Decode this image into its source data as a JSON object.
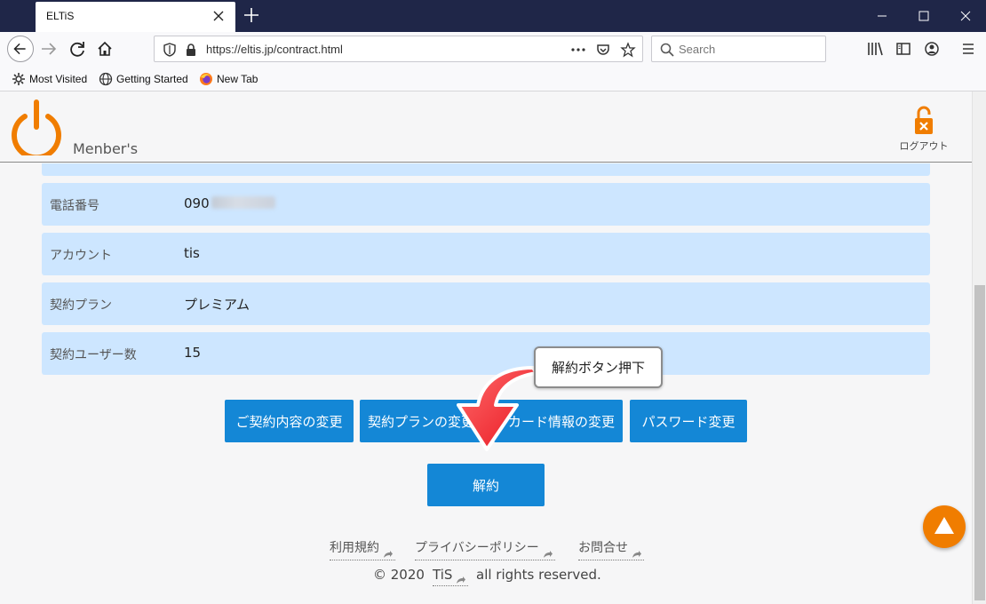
{
  "browser": {
    "tab_title": "ELTiS",
    "url": "https://eltis.jp/contract.html",
    "search_placeholder": "Search",
    "bookmarks": [
      "Most Visited",
      "Getting Started",
      "New Tab"
    ]
  },
  "header": {
    "brand": "Menber's",
    "logout_label": "ログアウト",
    "accent_color": "#f07d00"
  },
  "info_rows": [
    {
      "label": "電話番号",
      "value": "090"
    },
    {
      "label": "アカウント",
      "value": "tis"
    },
    {
      "label": "契約プラン",
      "value": "プレミアム"
    },
    {
      "label": "契約ユーザー数",
      "value": "15"
    }
  ],
  "actions": {
    "buttons": [
      "ご契約内容の変更",
      "契約プランの変更",
      "カード情報の変更",
      "パスワード変更"
    ],
    "cancel": "解約",
    "button_color": "#1487d6"
  },
  "callout": {
    "text": "解約ボタン押下",
    "arrow_color": "#ff2d3a"
  },
  "footer": {
    "links": [
      "利用規約",
      "プライバシーポリシー",
      "お問合せ"
    ],
    "copyright_prefix": "© 2020",
    "copyright_link": "TiS",
    "copyright_suffix": "all rights reserved."
  }
}
